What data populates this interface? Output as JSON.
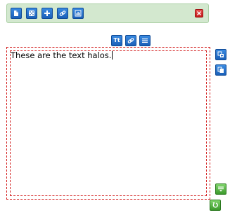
{
  "toolbar": {
    "buttons": [
      {
        "name": "document-icon"
      },
      {
        "name": "dice-icon"
      },
      {
        "name": "plus-icon"
      },
      {
        "name": "link-icon"
      },
      {
        "name": "chart-icon"
      }
    ],
    "close_icon": "close-icon"
  },
  "halo": {
    "top_buttons": [
      {
        "name": "text-style-button",
        "label": "Tt"
      },
      {
        "name": "link-button"
      },
      {
        "name": "align-button"
      }
    ],
    "side_buttons": [
      {
        "name": "resize-copy-button",
        "color": "blue"
      },
      {
        "name": "duplicate-button",
        "color": "blue"
      },
      {
        "name": "collapse-button",
        "color": "green"
      },
      {
        "name": "rotate-button",
        "color": "green"
      }
    ]
  },
  "text_box": {
    "content": "These are the text halos."
  },
  "colors": {
    "toolbar_bg": "#d3e8cf",
    "button_blue": "#1a5fb8",
    "close_red": "#c21b1b",
    "frame_dash": "#d21e1e",
    "button_green": "#3c9a2c"
  }
}
